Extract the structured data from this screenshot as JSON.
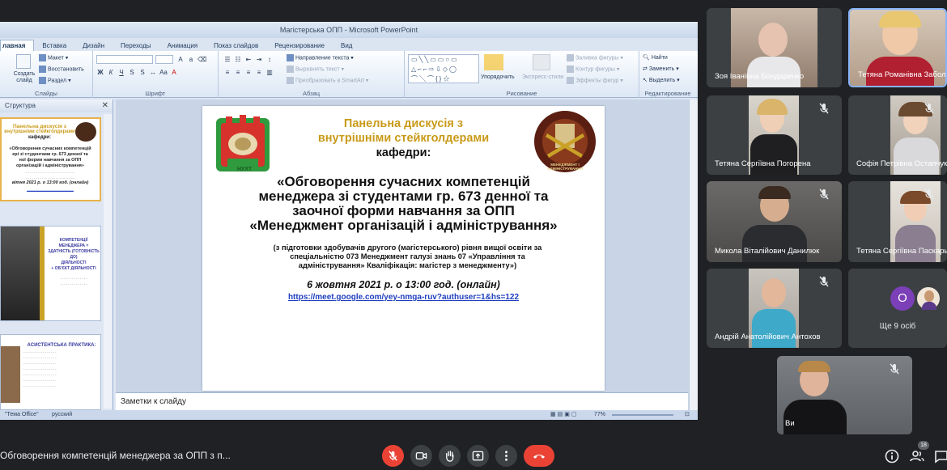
{
  "ppt": {
    "window_title": "Магістерська ОПП - Microsoft PowerPoint",
    "tabs": [
      "лавная",
      "Вставка",
      "Дизайн",
      "Переходы",
      "Анимация",
      "Показ слайдов",
      "Рецензирование",
      "Вид"
    ],
    "ribbon": {
      "slides_group": "Слайды",
      "create_slide": "Создать слайд",
      "layout": "Макет",
      "restore": "Восстановить",
      "section": "Раздел",
      "font_group": "Шрифт",
      "paragraph_group": "Абзац",
      "text_direction": "Направление текста",
      "align_text": "Выровнять текст",
      "smartart": "Преобразовать в SmartArt",
      "arrange": "Упорядочить",
      "quick_styles": "Экспресс-стили",
      "shape_fill": "Заливка фигуры",
      "shape_outline": "Контур фигуры",
      "shape_effects": "Эффекты фигур",
      "drawing_group": "Рисование",
      "find": "Найти",
      "replace": "Заменить",
      "select": "Выделить",
      "editing_group": "Редактирование"
    },
    "outline_tab": "Структура",
    "thumb1": [
      "Панельна дискусія з",
      "внутрішніми стейкголдерами",
      "кафедри:",
      "«Обговорення сучасних компетенцій",
      "ері зі студентами гр. 673 денної та",
      "ної форми навчання за ОПП",
      "організацій і адміністрування»",
      "вітня 2021 р. о 13:00 год. (онлайн)"
    ],
    "thumb2": [
      "КОМПЕТЕНЦІЇ",
      "МЕНЕДЖЕРА =",
      "ЗДАТНІСТЬ (ГОТОВНІСТЬ ДО)",
      "ДІЯЛЬНОСТІ",
      "+ ОБ'ЄКТ ДІЯЛЬНОСТІ"
    ],
    "thumb3": [
      "АСИСТЕНТСЬКА ПРАКТИКА:"
    ],
    "notes_placeholder": "Заметки к слайду",
    "status_theme": "\"Тема Office\"",
    "status_lang": "русский",
    "zoom": "77%"
  },
  "slide": {
    "title_line1": "Панельна дискусія з",
    "title_line2": "внутрішніми стейкголдерами",
    "title_line3": "кафедри:",
    "topic_line1": "«Обговорення сучасних компетенцій",
    "topic_line2": "менеджера зі студентами гр. 673 денної та",
    "topic_line3": "заочної форми навчання за ОПП",
    "topic_line4": "«Менеджмент організацій і адміністрування»",
    "detail_line1": "(з підготовки здобувачів другого (магістерського) рівня вищої освіти за",
    "detail_line2": "спеціальністю 073 Менеджмент галузі знань 07 «Управління та",
    "detail_line3": "адміністрування» Кваліфікація: магістер з менеджменту»)",
    "date": "6 жовтня 2021 р. о 13:00 год. (онлайн)",
    "link": "https://meet.google.com/yey-nmga-ruv?authuser=1&hs=122",
    "logo_left_text": "НУХТ",
    "logo_right_text": "МЕНЕДЖМЕНТ І АДМІНІСТРУВАННЯ"
  },
  "participants": {
    "p1": "Зоя Іванівна Бондаренко",
    "p2": "Тетяна Романівна Заболотна",
    "p3": "Тетяна Сергіївна Погорена",
    "p4": "Софія Петрівна Остапчук",
    "p5": "Микола Віталійович Данилюк",
    "p6": "Тетяна Сергіївна Паскарь",
    "p7": "Андрій Анатолійович Антохов",
    "more_avatar": "О",
    "more_label": "Ще 9 осіб",
    "self": "Ви"
  },
  "meeting": {
    "title": "Обговорення компетенцій менеджера за ОПП з п...",
    "people_count": "18"
  },
  "colors": {
    "meet_bg": "#202124",
    "tile_bg": "#3c4043",
    "hangup": "#ea4335",
    "active_speaker": "#8ab4f8",
    "slide_title": "#c99a18"
  }
}
